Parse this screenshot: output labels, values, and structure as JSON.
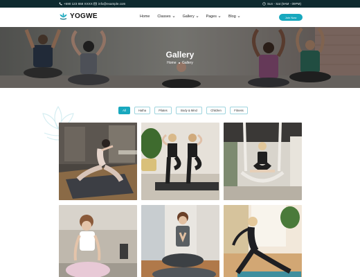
{
  "topbar": {
    "phone": "+590 123 658 XXXX",
    "email": "info@example.com",
    "hours": "Sun - Sat (9AM - 09PM)"
  },
  "header": {
    "logo_text": "YOGWE",
    "nav": [
      {
        "label": "Home",
        "has_dropdown": false
      },
      {
        "label": "Classes",
        "has_dropdown": true
      },
      {
        "label": "Gallery",
        "has_dropdown": true
      },
      {
        "label": "Pages",
        "has_dropdown": true
      },
      {
        "label": "Blog",
        "has_dropdown": true
      }
    ],
    "cta_label": "Join Now"
  },
  "hero": {
    "title": "Gallery",
    "breadcrumb": [
      "Home",
      "Gallery"
    ]
  },
  "filters": [
    {
      "label": "All",
      "active": true
    },
    {
      "label": "Hatha",
      "active": false
    },
    {
      "label": "Pilates",
      "active": false
    },
    {
      "label": "Body & Mind",
      "active": false
    },
    {
      "label": "Children",
      "active": false
    },
    {
      "label": "Fitness",
      "active": false
    }
  ],
  "gallery": [
    {
      "caption": "",
      "scene": "woman-stretch-studio"
    },
    {
      "caption": "",
      "scene": "two-women-tree-pose"
    },
    {
      "caption": "",
      "scene": "aerial-yoga-hammock"
    },
    {
      "caption": "",
      "scene": "woman-meditating-home"
    },
    {
      "caption": "",
      "scene": "woman-namaste-mat"
    },
    {
      "caption": "",
      "scene": "woman-side-stretch"
    }
  ],
  "colors": {
    "accent": "#18a8be",
    "topbar_bg": "#0e2a2f"
  }
}
